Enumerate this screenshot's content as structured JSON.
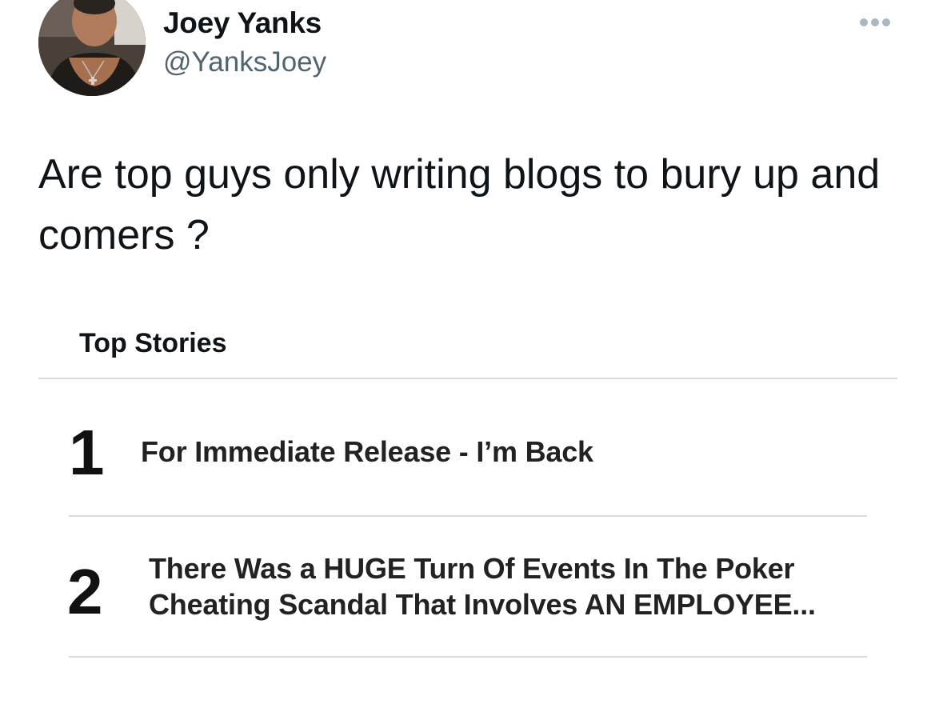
{
  "author": {
    "display_name": "Joey Yanks",
    "handle": "@YanksJoey"
  },
  "tweet": {
    "text": "Are top guys only writing blogs to bury up and comers ?"
  },
  "card": {
    "title": "Top Stories",
    "stories": [
      {
        "rank": "1",
        "headline": "For Immediate Release - I’m Back"
      },
      {
        "rank": "2",
        "headline": "There Was a HUGE Turn Of Events In The Poker Cheating Scandal That Involves AN EMPLOYEE..."
      }
    ]
  },
  "icons": {
    "more": "more-options-icon",
    "avatar": "profile-photo"
  },
  "colors": {
    "text_primary": "#0f1419",
    "text_secondary": "#536471",
    "divider": "#d9dcdf",
    "more_icon": "#aab8c2"
  }
}
